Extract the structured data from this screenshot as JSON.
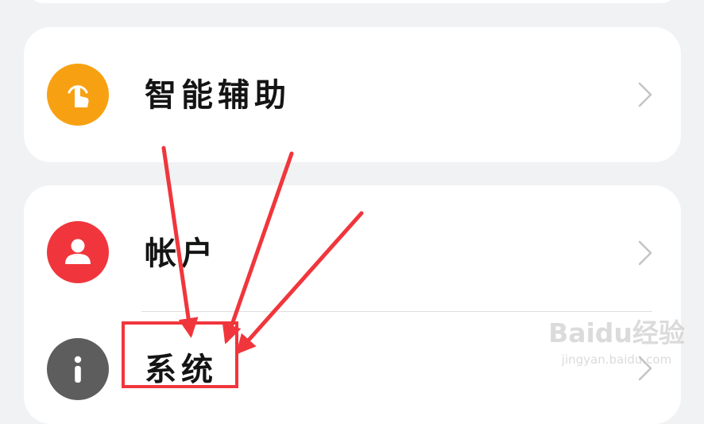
{
  "settings": {
    "items": [
      {
        "label": "智能辅助",
        "icon": "hand-tap-icon",
        "icon_color": "#f7a112"
      },
      {
        "label": "帐户",
        "icon": "user-icon",
        "icon_color": "#f0363c"
      },
      {
        "label": "系统",
        "icon": "info-icon",
        "icon_color": "#5d5d5d"
      }
    ]
  },
  "annotation": {
    "color": "#f0363c"
  },
  "watermark": {
    "logo": "Baidu经验",
    "url": "jingyan.baidu.com"
  }
}
